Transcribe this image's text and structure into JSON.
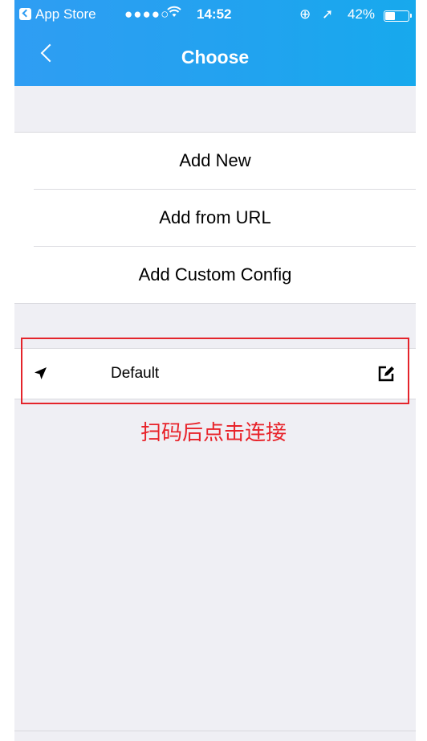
{
  "status_bar": {
    "back_app": "App Store",
    "signal": "●●●●○",
    "wifi": "ᯤ",
    "time": "14:52",
    "lock": "⊕",
    "location": "➚",
    "battery": "42%",
    "battery_level": 0.42
  },
  "nav": {
    "title": "Choose"
  },
  "menu": {
    "items": [
      {
        "label": "Add New"
      },
      {
        "label": "Add from URL"
      },
      {
        "label": "Add Custom Config"
      }
    ]
  },
  "config_row": {
    "label": "Default"
  },
  "annotation": {
    "text": "扫码后点击连接",
    "color": "#e8232a"
  },
  "colors": {
    "nav_bar": "#21a3ef",
    "background": "#efeff4",
    "highlight": "#e4242b"
  }
}
